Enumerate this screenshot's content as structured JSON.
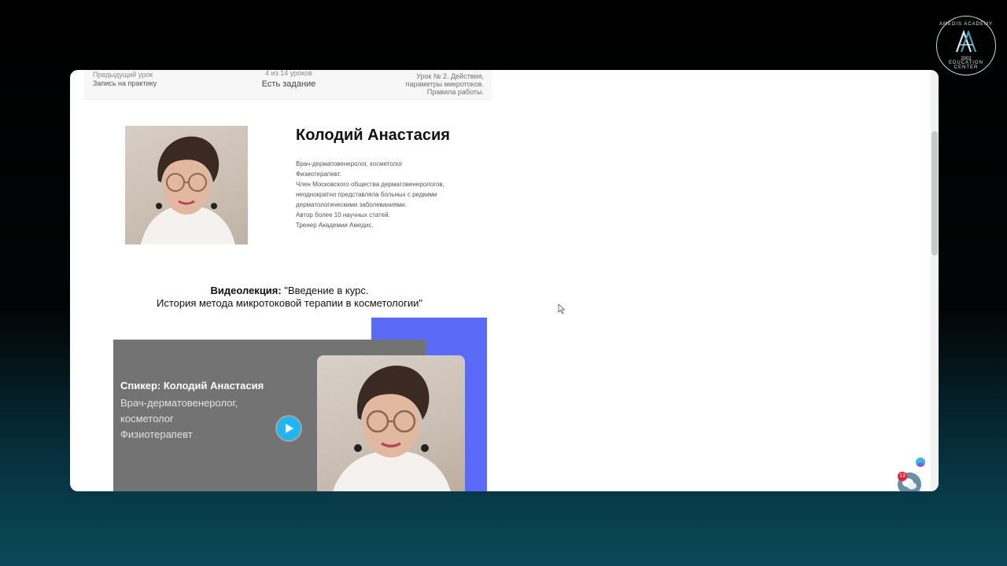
{
  "logo": {
    "top_text": "AMEDIS ACADEMY",
    "bottom_text": "EDUCATION CENTER",
    "year": "2002"
  },
  "lesson_nav": {
    "prev_label": "Предыдущий урок",
    "prev_title": "Запись на практику",
    "counter": "4 из 14 уроков",
    "task": "Есть задание",
    "next_lines": [
      "Урок № 2. Действия,",
      "параметры микротоков.",
      "Правила работы."
    ]
  },
  "author": {
    "name": "Колодий Анастасия",
    "bio": [
      "Врач-дерматовенеролог, косметолог",
      "Физиотерапевт.",
      "Член Московского общества дерматовенерологов,",
      "неоднократно представляла больных с редкими",
      "дерматологическими заболеваниями.",
      "Автор более 10 научных статей.",
      "Тренер Академии Амедис."
    ]
  },
  "lecture": {
    "prefix": "Видеолекция:",
    "line1": " \"Введение в курс.",
    "line2": "История метода микротоковой терапии в косметологии\""
  },
  "video": {
    "speaker": "Спикер: Колодий Анастасия",
    "role_lines": [
      "Врач-дерматовенеролог,",
      "косметолог",
      "Физиотерапевт"
    ]
  },
  "chat": {
    "badge_count": "13"
  },
  "colors": {
    "accent_blue": "#5a6cf7",
    "play_button": "#1fb6f4",
    "video_card": "#737373",
    "badge": "#e0213a"
  },
  "icons": [
    "play-icon",
    "chat-icon",
    "mouse-cursor-icon",
    "widget-icon"
  ]
}
